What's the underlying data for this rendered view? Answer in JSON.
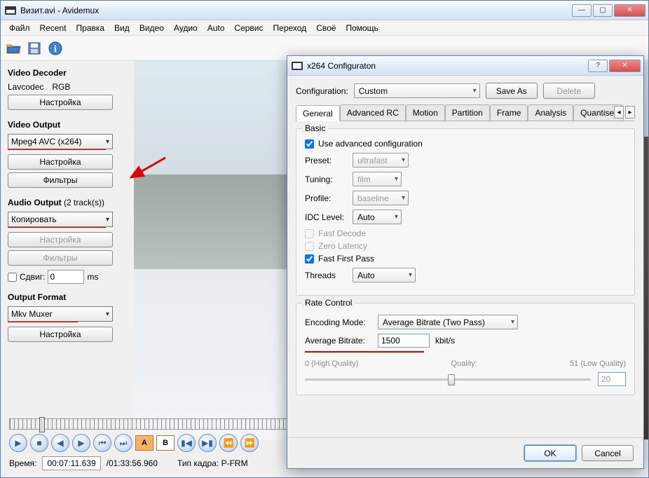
{
  "titlebar": {
    "title": "Визит.avi - Avidemux"
  },
  "menu": [
    "Файл",
    "Recent",
    "Правка",
    "Вид",
    "Видео",
    "Аудио",
    "Auto",
    "Сервис",
    "Переход",
    "Своё",
    "Помощь"
  ],
  "left": {
    "video_decoder": "Video Decoder",
    "lavcodec": "Lavcodec",
    "rgb": "RGB",
    "settings": "Настройка",
    "video_output": "Video Output",
    "vcodec": "Mpeg4 AVC (x264)",
    "filters": "Фильтры",
    "audio_output": "Audio Output",
    "tracks": "(2 track(s))",
    "acodec": "Копировать",
    "shift": "Сдвиг:",
    "shift_val": "0",
    "ms": "ms",
    "output_format": "Output Format",
    "muxer": "Mkv Muxer"
  },
  "status": {
    "time_label": "Время:",
    "time_val": "00:07:11.639",
    "duration": "/01:33:56.960",
    "frame_label": "Тип кадра:",
    "frame_type": "P-FRM"
  },
  "dialog": {
    "title": "x264 Configuraton",
    "cfg_label": "Configuration:",
    "cfg_value": "Custom",
    "save_as": "Save As",
    "delete": "Delete",
    "tabs": [
      "General",
      "Advanced RC",
      "Motion",
      "Partition",
      "Frame",
      "Analysis",
      "Quantiser"
    ],
    "basic": "Basic",
    "use_advanced": "Use advanced configuration",
    "preset": "Preset:",
    "preset_val": "ultrafast",
    "tuning": "Tuning:",
    "tuning_val": "film",
    "profile": "Profile:",
    "profile_val": "baseline",
    "idc": "IDC Level:",
    "idc_val": "Auto",
    "fast_decode": "Fast Decode",
    "zero_latency": "Zero Latency",
    "fast_first": "Fast First Pass",
    "threads": "Threads",
    "threads_val": "Auto",
    "rate_control": "Rate Control",
    "encoding_mode": "Encoding Mode:",
    "encoding_val": "Average Bitrate (Two Pass)",
    "avg_bitrate": "Average Bitrate:",
    "bitrate_val": "1500",
    "kbits": "kbit/s",
    "hq": "0 (High Quality)",
    "quality": "Quality:",
    "lq": "51 (Low Quality)",
    "qval": "20",
    "ok": "OK",
    "cancel": "Cancel"
  }
}
